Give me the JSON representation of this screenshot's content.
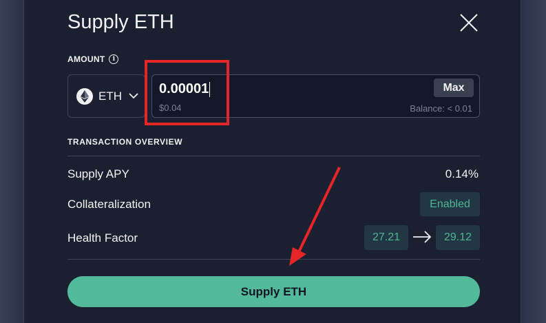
{
  "modal": {
    "title": "Supply ETH",
    "close_icon": "close-icon"
  },
  "amount": {
    "label": "AMOUNT",
    "info_icon": "info-icon",
    "token": "ETH",
    "token_icon": "ethereum-icon",
    "value": "0.00001",
    "usd_value": "$0.04",
    "max_label": "Max",
    "balance": "Balance: < 0.01"
  },
  "overview": {
    "heading": "TRANSACTION OVERVIEW",
    "supply_apy_label": "Supply APY",
    "supply_apy_value": "0.14%",
    "collateral_label": "Collateralization",
    "collateral_value": "Enabled",
    "health_factor_label": "Health Factor",
    "health_factor_from": "27.21",
    "health_factor_to": "29.12"
  },
  "action": {
    "supply_label": "Supply ETH"
  },
  "colors": {
    "accent": "#52b99a",
    "annotation": "#e52528",
    "background": "#1b2030"
  }
}
